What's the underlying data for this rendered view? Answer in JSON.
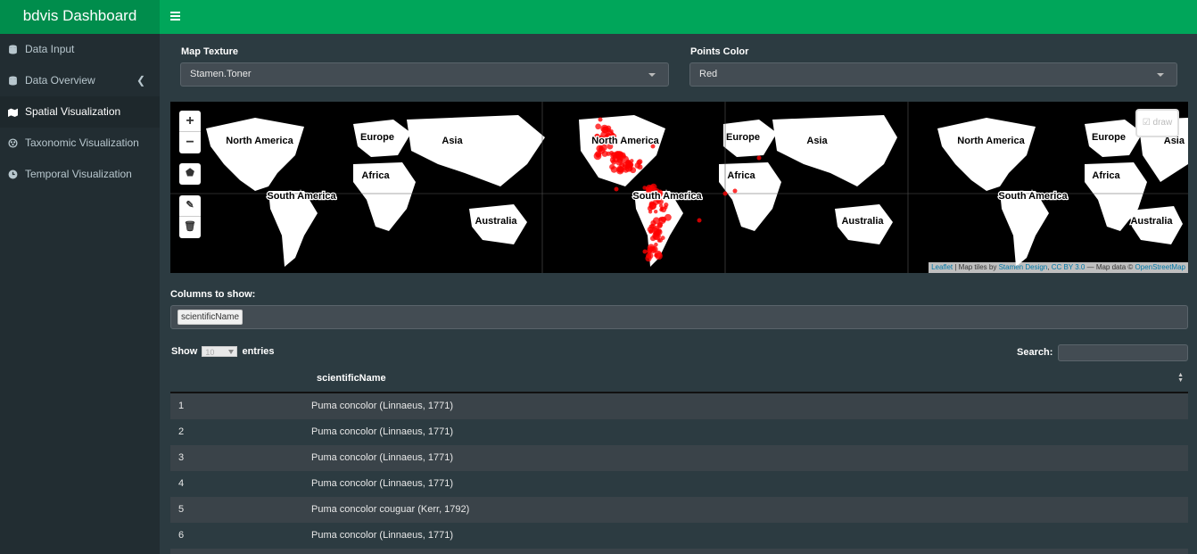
{
  "app": {
    "title": "bdvis Dashboard"
  },
  "sidebar": {
    "items": [
      {
        "label": "Data Input",
        "icon": "database-icon"
      },
      {
        "label": "Data Overview",
        "icon": "database-icon"
      },
      {
        "label": "Spatial Visualization",
        "icon": "map-icon"
      },
      {
        "label": "Taxonomic Visualization",
        "icon": "tree-icon"
      },
      {
        "label": "Temporal Visualization",
        "icon": "clock-icon"
      }
    ]
  },
  "controls": {
    "map_texture_label": "Map Texture",
    "map_texture_value": "Stamen.Toner",
    "points_color_label": "Points Color",
    "points_color_value": "Red"
  },
  "map": {
    "labels": [
      "North America",
      "South America",
      "Europe",
      "Asia",
      "Africa",
      "Australia"
    ],
    "attribution": {
      "leaflet": "Leaflet",
      "sep1": " | Map tiles by ",
      "stamen": "Stamen Design",
      "sep2": ", ",
      "cc": "CC BY 3.0",
      "sep3": " — Map data © ",
      "osm": "OpenStreetMap"
    },
    "draw_label": "draw",
    "zoom_in": "+",
    "zoom_out": "−",
    "point_color": "#ff0000"
  },
  "columns": {
    "label": "Columns to show:",
    "chip": "scientificName"
  },
  "table": {
    "show_prefix": "Show",
    "length_value": "10",
    "show_suffix": "entries",
    "search_label": "Search:",
    "header": "scientificName",
    "rows": [
      {
        "n": "1",
        "name": "Puma concolor (Linnaeus, 1771)"
      },
      {
        "n": "2",
        "name": "Puma concolor (Linnaeus, 1771)"
      },
      {
        "n": "3",
        "name": "Puma concolor (Linnaeus, 1771)"
      },
      {
        "n": "4",
        "name": "Puma concolor (Linnaeus, 1771)"
      },
      {
        "n": "5",
        "name": "Puma concolor couguar (Kerr, 1792)"
      },
      {
        "n": "6",
        "name": "Puma concolor (Linnaeus, 1771)"
      }
    ]
  },
  "colors": {
    "brand": "#008d4c",
    "header": "#00a65a",
    "sidebar": "#222d32",
    "content": "#2c3b41"
  }
}
